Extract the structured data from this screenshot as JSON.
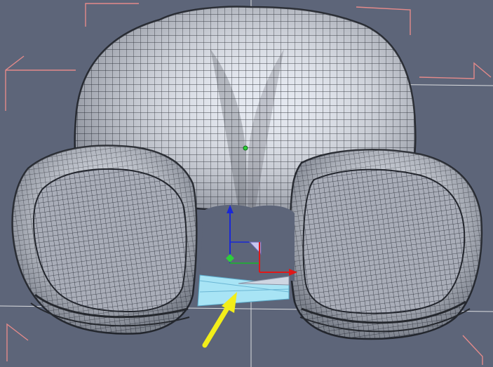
{
  "viewport": {
    "background": "#5d6579",
    "model": "femur-condyle-wireframe-mesh",
    "mesh_color": "#e8ecf4",
    "wire_color": "#2b2f36",
    "highlight_color": "#a8e4f5",
    "annotation_arrow_color": "#f2ee1a"
  },
  "gizmo": {
    "x_axis_color": "#e01818",
    "y_axis_color": "#1a28d6",
    "z_axis_color": "#18b82a",
    "pivot_color": "#2ecf3a"
  },
  "bounding_box_corner_color": "#e48a8a",
  "crosshair_color": "#f2f2f2"
}
